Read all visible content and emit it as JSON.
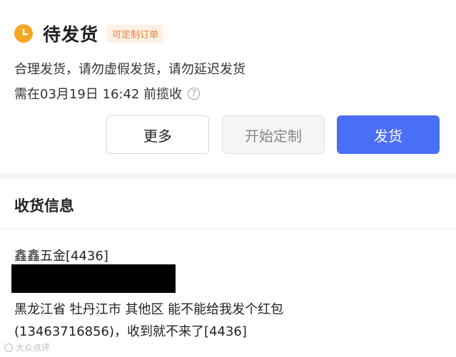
{
  "order": {
    "status_title": "待发货",
    "badge": "可定制订单",
    "note": "合理发货，请勿虚假发货，请勿延迟发货",
    "deadline": "需在03月19日 16:42 前揽收",
    "help_glyph": "?"
  },
  "actions": {
    "more": "更多",
    "start_custom": "开始定制",
    "ship": "发货"
  },
  "shipping": {
    "title": "收货信息",
    "name": "鑫鑫五金[4436]",
    "address_line1": "黑龙江省 牡丹江市 其他区 能不能给我发个红包",
    "address_line2": "(13463716856)，收到就不来了[4436]"
  },
  "watermark": "大众点评",
  "colors": {
    "accent": "#4a6ef5",
    "status_icon": "#f5a623",
    "badge_text": "#e8803a"
  }
}
